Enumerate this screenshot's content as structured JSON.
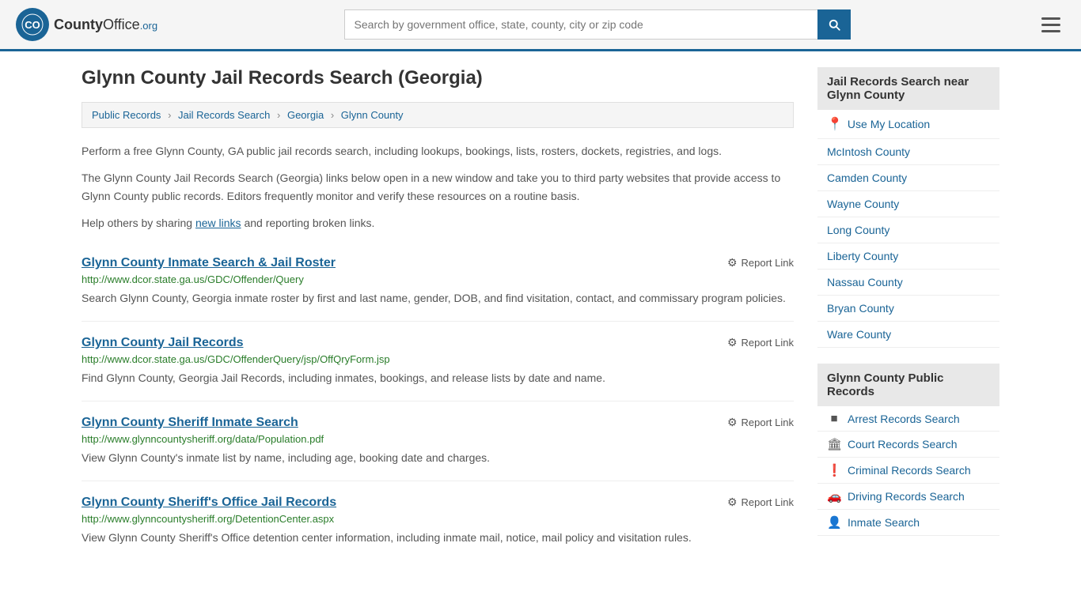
{
  "header": {
    "logo_text": "County",
    "logo_org": "Office",
    "logo_suffix": ".org",
    "search_placeholder": "Search by government office, state, county, city or zip code",
    "search_value": ""
  },
  "page": {
    "title": "Glynn County Jail Records Search (Georgia)"
  },
  "breadcrumb": {
    "items": [
      {
        "label": "Public Records",
        "href": "#"
      },
      {
        "label": "Jail Records Search",
        "href": "#"
      },
      {
        "label": "Georgia",
        "href": "#"
      },
      {
        "label": "Glynn County",
        "href": "#"
      }
    ]
  },
  "description": {
    "intro": "Perform a free Glynn County, GA public jail records search, including lookups, bookings, lists, rosters, dockets, registries, and logs.",
    "detail": "The Glynn County Jail Records Search (Georgia) links below open in a new window and take you to third party websites that provide access to Glynn County public records. Editors frequently monitor and verify these resources on a routine basis.",
    "help": "Help others by sharing ",
    "new_links": "new links",
    "help_suffix": " and reporting broken links."
  },
  "results": [
    {
      "id": 1,
      "title": "Glynn County Inmate Search & Jail Roster",
      "url": "http://www.dcor.state.ga.us/GDC/Offender/Query",
      "description": "Search Glynn County, Georgia inmate roster by first and last name, gender, DOB, and find visitation, contact, and commissary program policies.",
      "report_label": "Report Link"
    },
    {
      "id": 2,
      "title": "Glynn County Jail Records",
      "url": "http://www.dcor.state.ga.us/GDC/OffenderQuery/jsp/OffQryForm.jsp",
      "description": "Find Glynn County, Georgia Jail Records, including inmates, bookings, and release lists by date and name.",
      "report_label": "Report Link"
    },
    {
      "id": 3,
      "title": "Glynn County Sheriff Inmate Search",
      "url": "http://www.glynncountysheriff.org/data/Population.pdf",
      "description": "View Glynn County's inmate list by name, including age, booking date and charges.",
      "report_label": "Report Link"
    },
    {
      "id": 4,
      "title": "Glynn County Sheriff's Office Jail Records",
      "url": "http://www.glynncountysheriff.org/DetentionCenter.aspx",
      "description": "View Glynn County Sheriff's Office detention center information, including inmate mail, notice, mail policy and visitation rules.",
      "report_label": "Report Link"
    }
  ],
  "sidebar": {
    "nearby_title": "Jail Records Search near Glynn County",
    "use_location": "Use My Location",
    "nearby_counties": [
      "McIntosh County",
      "Camden County",
      "Wayne County",
      "Long County",
      "Liberty County",
      "Nassau County",
      "Bryan County",
      "Ware County"
    ],
    "public_records_title": "Glynn County Public Records",
    "public_records": [
      {
        "label": "Arrest Records Search",
        "icon": "■"
      },
      {
        "label": "Court Records Search",
        "icon": "🏛"
      },
      {
        "label": "Criminal Records Search",
        "icon": "❗"
      },
      {
        "label": "Driving Records Search",
        "icon": "🚗"
      },
      {
        "label": "Inmate Search",
        "icon": "👤"
      }
    ]
  }
}
